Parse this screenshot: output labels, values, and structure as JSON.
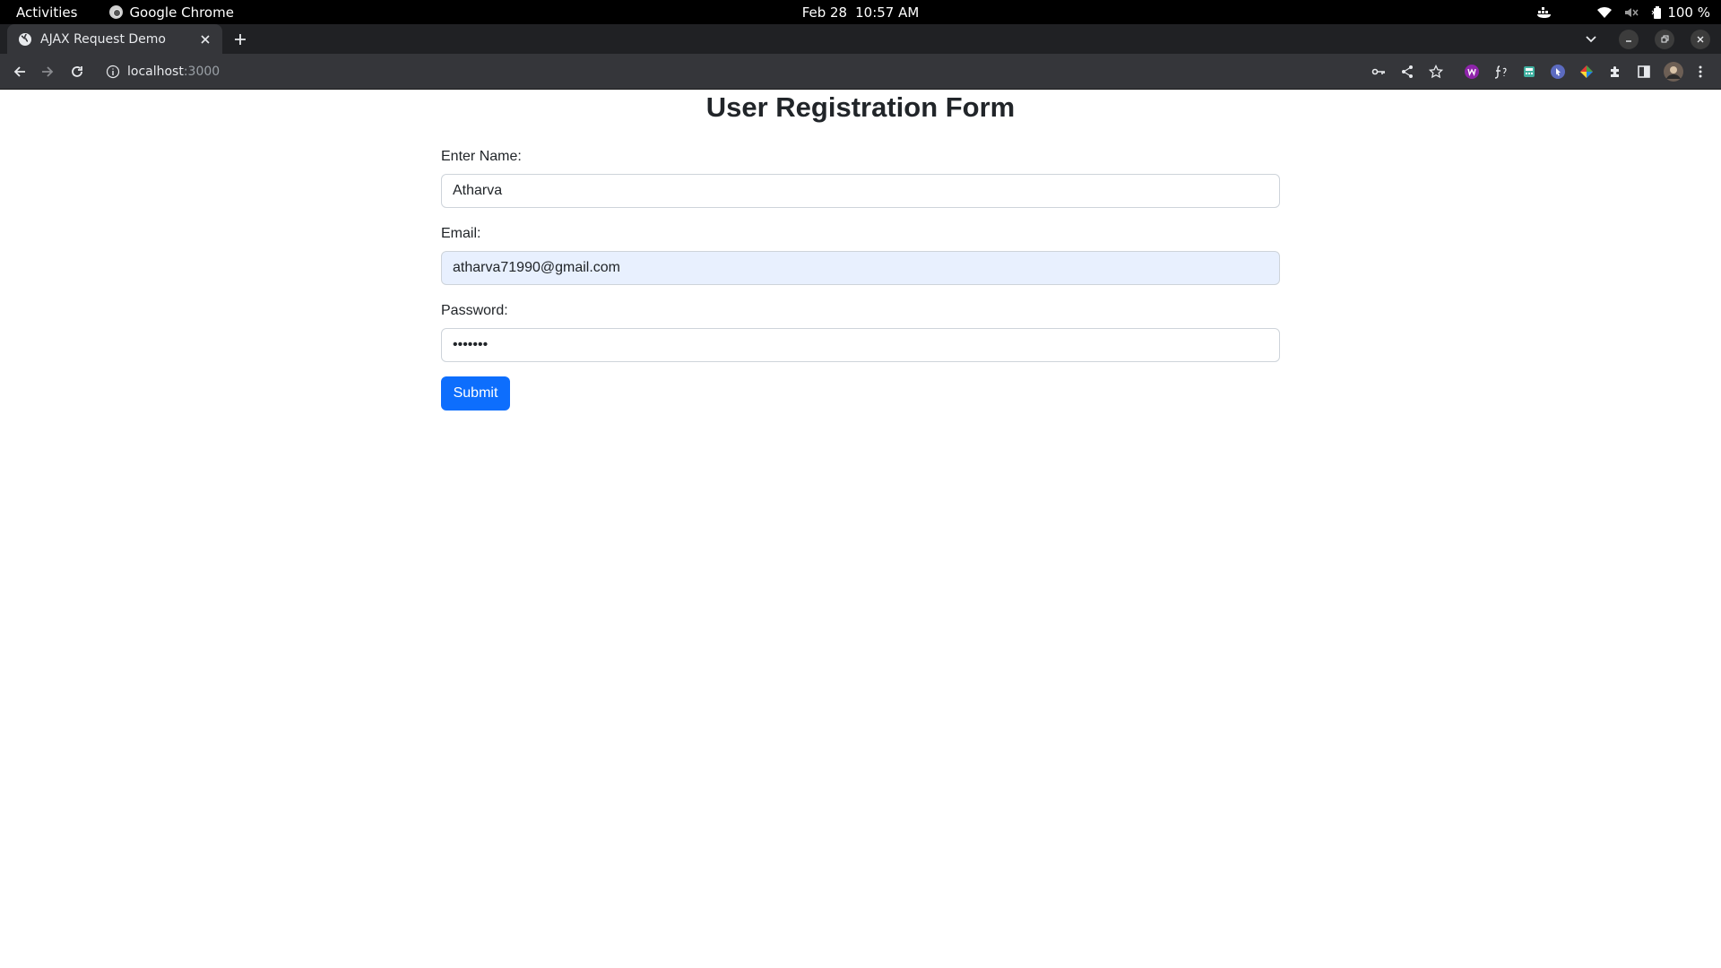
{
  "topbar": {
    "activities": "Activities",
    "app_name": "Google Chrome",
    "date": "Feb 28",
    "time": "10:57 AM",
    "battery": "100 %"
  },
  "browser": {
    "tab_title": "AJAX Request Demo",
    "url_host": "localhost",
    "url_port": ":3000"
  },
  "page": {
    "title": "User Registration Form",
    "name_label": "Enter Name:",
    "name_value": "Atharva",
    "email_label": "Email:",
    "email_value": "atharva71990@gmail.com",
    "password_label": "Password:",
    "password_value": "•••••••",
    "submit_label": "Submit"
  },
  "colors": {
    "primary_button": "#0d6efd",
    "autofill_background": "#e8f0fe"
  }
}
